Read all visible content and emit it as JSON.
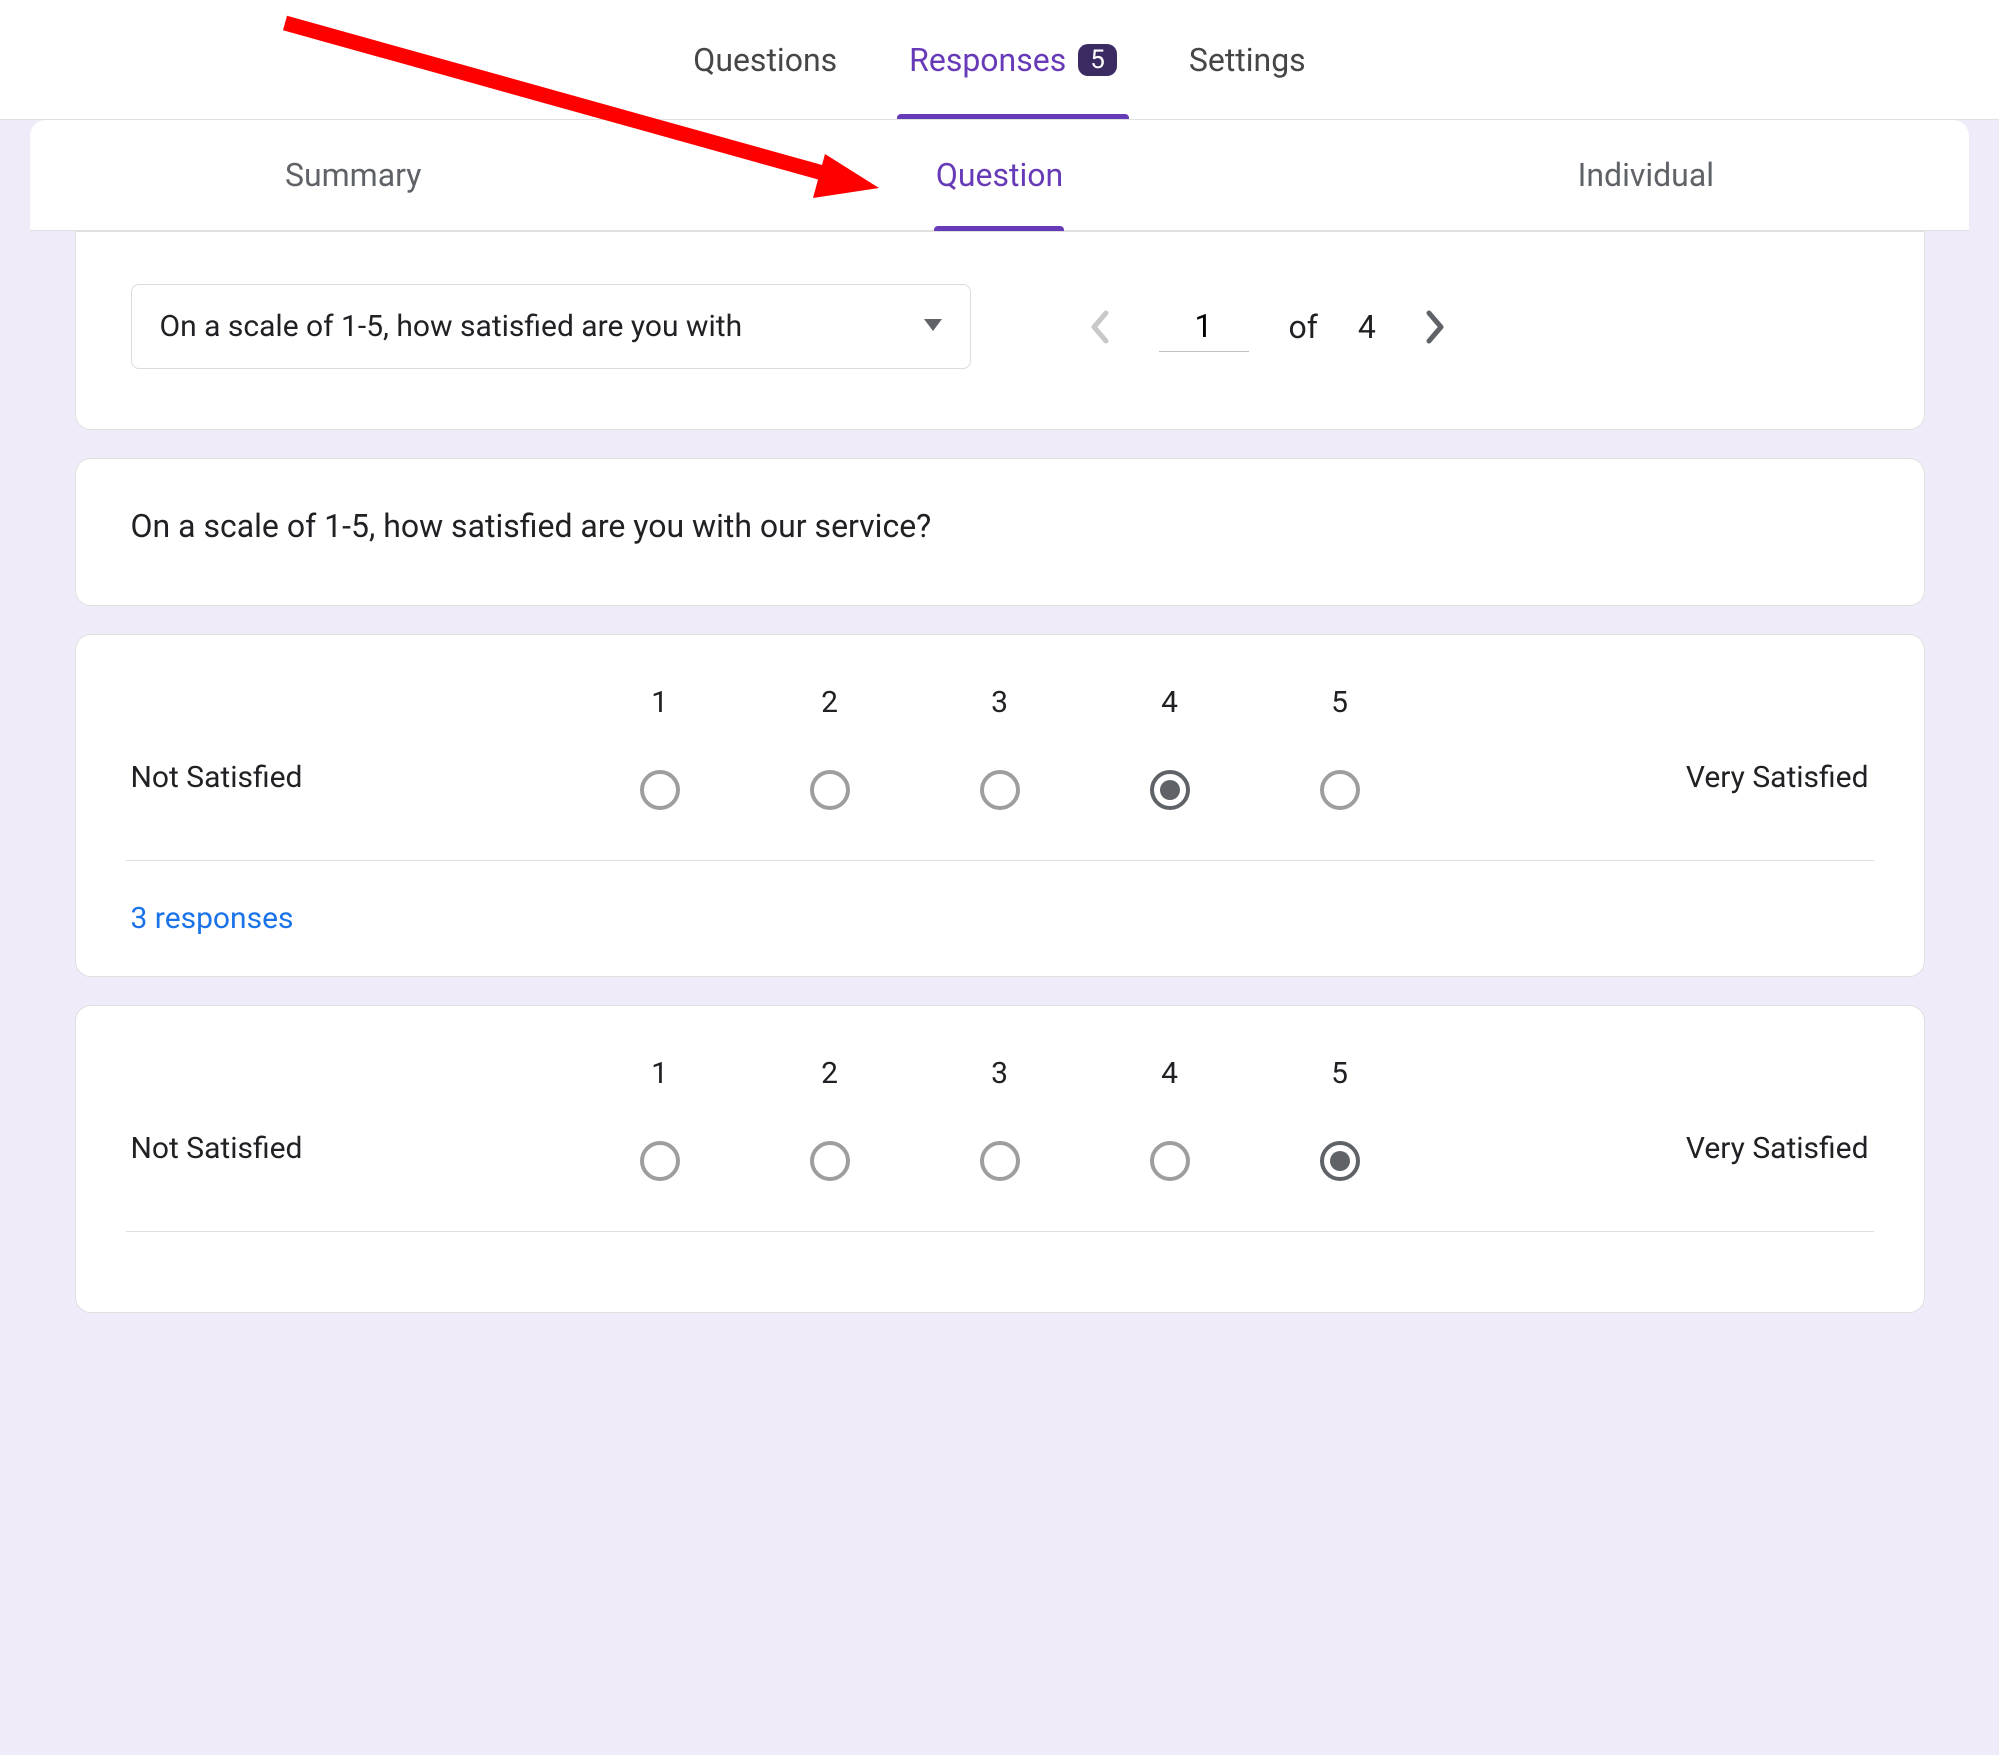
{
  "colors": {
    "accent": "#673ab7",
    "link": "#1a73e8",
    "text": "#202124",
    "muted": "#5f6368",
    "annotation": "#ff0000"
  },
  "topTabs": {
    "questions": "Questions",
    "responses": "Responses",
    "badge": "5",
    "settings": "Settings",
    "active": "responses"
  },
  "subTabs": {
    "summary": "Summary",
    "question": "Question",
    "individual": "Individual",
    "active": "question"
  },
  "selector": {
    "dropdownText": "On a scale of 1-5, how satisfied are you with",
    "currentPage": "1",
    "ofLabel": "of",
    "totalPages": "4"
  },
  "question": {
    "text": "On a scale of 1-5, how satisfied are you with our service?"
  },
  "scale": {
    "lowLabel": "Not Satisfied",
    "highLabel": "Very Satisfied",
    "options": [
      "1",
      "2",
      "3",
      "4",
      "5"
    ]
  },
  "responses": [
    {
      "selected": 4,
      "countLabel": "3 responses"
    },
    {
      "selected": 5,
      "countLabel": ""
    }
  ]
}
